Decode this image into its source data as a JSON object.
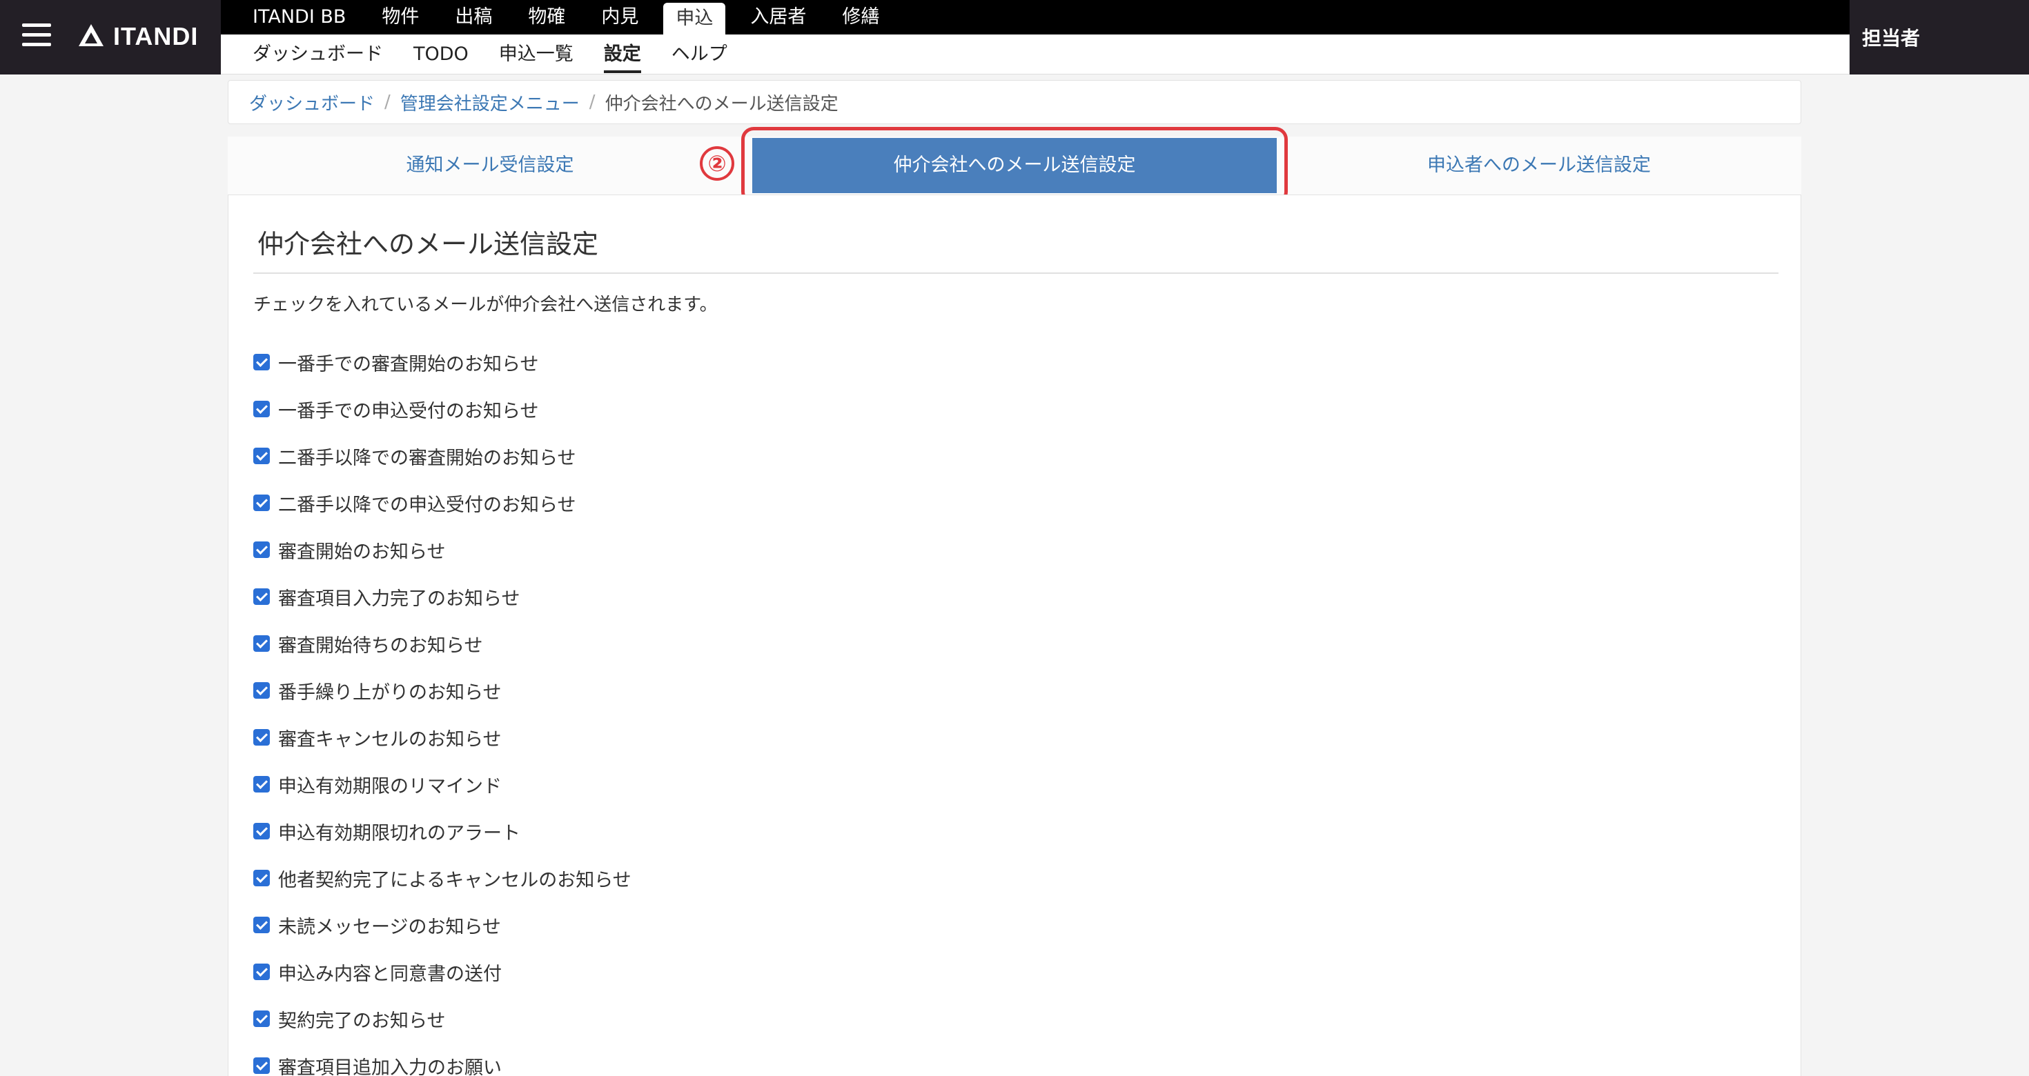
{
  "header": {
    "logo_text": "ITANDI",
    "main_nav": [
      "ITANDI BB",
      "物件",
      "出稿",
      "物確",
      "内見",
      "申込",
      "入居者",
      "修繕"
    ],
    "main_nav_active": "申込",
    "sub_nav": [
      "ダッシュボード",
      "TODO",
      "申込一覧",
      "設定",
      "ヘルプ"
    ],
    "sub_nav_active": "設定",
    "user": "担当者"
  },
  "breadcrumb": {
    "items": [
      "ダッシュボード",
      "管理会社設定メニュー"
    ],
    "current": "仲介会社へのメール送信設定"
  },
  "tabs": {
    "items": [
      "通知メール受信設定",
      "仲介会社へのメール送信設定",
      "申込者へのメール送信設定"
    ],
    "active": "仲介会社へのメール送信設定"
  },
  "step_marker": "②",
  "panel": {
    "title": "仲介会社へのメール送信設定",
    "description": "チェックを入れているメールが仲介会社へ送信されます。",
    "options": [
      {
        "label": "一番手での審査開始のお知らせ",
        "checked": true
      },
      {
        "label": "一番手での申込受付のお知らせ",
        "checked": true
      },
      {
        "label": "二番手以降での審査開始のお知らせ",
        "checked": true
      },
      {
        "label": "二番手以降での申込受付のお知らせ",
        "checked": true
      },
      {
        "label": "審査開始のお知らせ",
        "checked": true
      },
      {
        "label": "審査項目入力完了のお知らせ",
        "checked": true
      },
      {
        "label": "審査開始待ちのお知らせ",
        "checked": true
      },
      {
        "label": "番手繰り上がりのお知らせ",
        "checked": true
      },
      {
        "label": "審査キャンセルのお知らせ",
        "checked": true
      },
      {
        "label": "申込有効期限のリマインド",
        "checked": true
      },
      {
        "label": "申込有効期限切れのアラート",
        "checked": true
      },
      {
        "label": "他者契約完了によるキャンセルのお知らせ",
        "checked": true
      },
      {
        "label": "未読メッセージのお知らせ",
        "checked": true
      },
      {
        "label": "申込み内容と同意書の送付",
        "checked": true
      },
      {
        "label": "契約完了のお知らせ",
        "checked": true
      },
      {
        "label": "審査項目追加入力のお願い",
        "checked": true
      }
    ]
  },
  "colors": {
    "topbar": "#231f26",
    "accent": "#4a7fbc",
    "link": "#3c78b4",
    "highlight": "#e0393e",
    "checkbox": "#2a6fd6"
  }
}
